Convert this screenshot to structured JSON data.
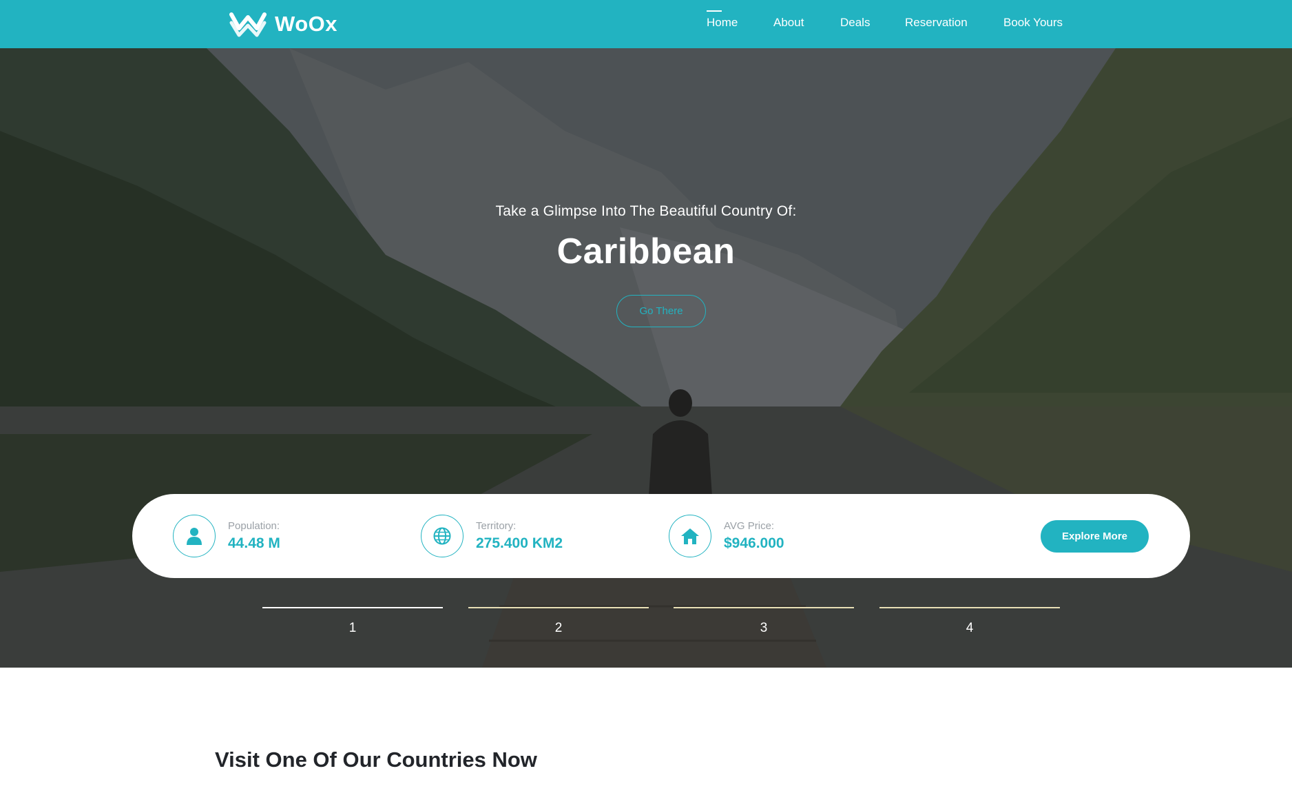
{
  "header": {
    "brand": "WoOx",
    "nav": [
      {
        "label": "Home",
        "active": true
      },
      {
        "label": "About",
        "active": false
      },
      {
        "label": "Deals",
        "active": false
      },
      {
        "label": "Reservation",
        "active": false
      },
      {
        "label": "Book Yours",
        "active": false
      }
    ]
  },
  "hero": {
    "subtitle": "Take a Glimpse Into The Beautiful Country Of:",
    "title": "Caribbean",
    "button": "Go There"
  },
  "stats": [
    {
      "label": "Population:",
      "value": "44.48 M",
      "icon": "user-icon"
    },
    {
      "label": "Territory:",
      "value": "275.400 KM2",
      "icon": "globe-icon"
    },
    {
      "label": "AVG Price:",
      "value": "$946.000",
      "icon": "home-icon"
    }
  ],
  "explore_button": "Explore More",
  "slides": [
    "1",
    "2",
    "3",
    "4"
  ],
  "section": {
    "title": "Visit One Of Our Countries Now"
  },
  "colors": {
    "accent": "#22b3c1",
    "indicator": "#e8dfb6",
    "heading": "#22252a"
  }
}
